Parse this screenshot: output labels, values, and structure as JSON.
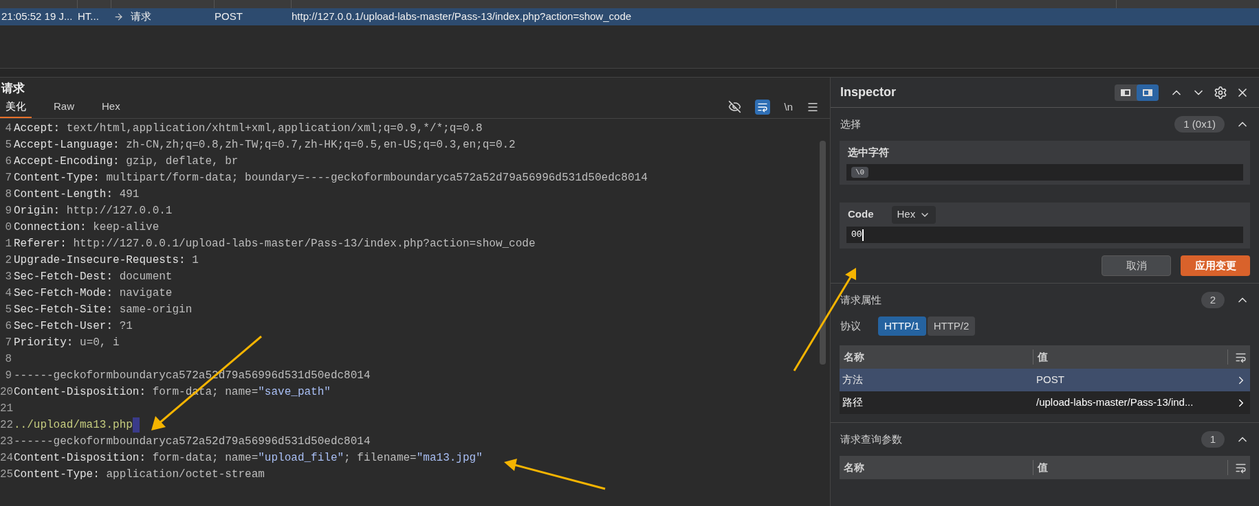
{
  "request_list": {
    "rows": [
      {
        "time": "21:05:52 19 J...",
        "type": "HT...",
        "direction": "请求",
        "method": "POST",
        "url": "http://127.0.0.1/upload-labs-master/Pass-13/index.php?action=show_code",
        "selected": true
      }
    ]
  },
  "request_panel": {
    "title": "请求",
    "tabs": [
      {
        "label": "美化",
        "selected": true
      },
      {
        "label": "Raw",
        "selected": false
      },
      {
        "label": "Hex",
        "selected": false
      }
    ],
    "toolbar": {
      "newline_label": "\\n",
      "wrap_on": true
    },
    "lines": [
      {
        "number": "4",
        "selected_char": false,
        "parts": [
          {
            "kind": "key",
            "text": "Accept:"
          },
          {
            "kind": "text",
            "text": " text/html,application/xhtml+xml,application/xml;q=0.9,*/*;q=0.8"
          }
        ]
      },
      {
        "number": "5",
        "selected_char": false,
        "parts": [
          {
            "kind": "key",
            "text": "Accept-Language:"
          },
          {
            "kind": "text",
            "text": " zh-CN,zh;q=0.8,zh-TW;q=0.7,zh-HK;q=0.5,en-US;q=0.3,en;q=0.2"
          }
        ]
      },
      {
        "number": "6",
        "selected_char": false,
        "parts": [
          {
            "kind": "key",
            "text": "Accept-Encoding:"
          },
          {
            "kind": "text",
            "text": " gzip, deflate, br"
          }
        ]
      },
      {
        "number": "7",
        "selected_char": false,
        "parts": [
          {
            "kind": "key",
            "text": "Content-Type:"
          },
          {
            "kind": "text",
            "text": " multipart/form-data; boundary=----geckoformboundaryca572a52d79a56996d531d50edc8014"
          }
        ]
      },
      {
        "number": "8",
        "selected_char": false,
        "parts": [
          {
            "kind": "key",
            "text": "Content-Length:"
          },
          {
            "kind": "text",
            "text": " 491"
          }
        ]
      },
      {
        "number": "9",
        "selected_char": false,
        "parts": [
          {
            "kind": "key",
            "text": "Origin:"
          },
          {
            "kind": "text",
            "text": " http://127.0.0.1"
          }
        ]
      },
      {
        "number": "0",
        "selected_char": false,
        "parts": [
          {
            "kind": "key",
            "text": "Connection:"
          },
          {
            "kind": "text",
            "text": " keep-alive"
          }
        ]
      },
      {
        "number": "1",
        "selected_char": false,
        "parts": [
          {
            "kind": "key",
            "text": "Referer:"
          },
          {
            "kind": "text",
            "text": " http://127.0.0.1/upload-labs-master/Pass-13/index.php?action=show_code"
          }
        ]
      },
      {
        "number": "2",
        "selected_char": false,
        "parts": [
          {
            "kind": "key",
            "text": "Upgrade-Insecure-Requests:"
          },
          {
            "kind": "text",
            "text": " 1"
          }
        ]
      },
      {
        "number": "3",
        "selected_char": false,
        "parts": [
          {
            "kind": "key",
            "text": "Sec-Fetch-Dest:"
          },
          {
            "kind": "text",
            "text": " document"
          }
        ]
      },
      {
        "number": "4",
        "selected_char": false,
        "parts": [
          {
            "kind": "key",
            "text": "Sec-Fetch-Mode:"
          },
          {
            "kind": "text",
            "text": " navigate"
          }
        ]
      },
      {
        "number": "5",
        "selected_char": false,
        "parts": [
          {
            "kind": "key",
            "text": "Sec-Fetch-Site:"
          },
          {
            "kind": "text",
            "text": " same-origin"
          }
        ]
      },
      {
        "number": "6",
        "selected_char": false,
        "parts": [
          {
            "kind": "key",
            "text": "Sec-Fetch-User:"
          },
          {
            "kind": "text",
            "text": " ?1"
          }
        ]
      },
      {
        "number": "7",
        "selected_char": false,
        "parts": [
          {
            "kind": "key",
            "text": "Priority:"
          },
          {
            "kind": "text",
            "text": " u=0, i"
          }
        ]
      },
      {
        "number": "8",
        "selected_char": false
      },
      {
        "number": "9",
        "selected_char": false,
        "parts": [
          {
            "kind": "text",
            "text": "------geckoformboundaryca572a52d79a56996d531d50edc8014"
          }
        ]
      },
      {
        "number": "20",
        "selected_char": false,
        "parts": [
          {
            "kind": "key",
            "text": "Content-Disposition:"
          },
          {
            "kind": "text",
            "text": " form-data; name="
          },
          {
            "kind": "string",
            "text": "\"save_path\""
          }
        ]
      },
      {
        "number": "21",
        "selected_char": false
      },
      {
        "number": "22",
        "selected_char": true,
        "parts": [
          {
            "kind": "body",
            "text": "../upload/ma13.php"
          }
        ]
      },
      {
        "number": "23",
        "selected_char": false,
        "parts": [
          {
            "kind": "text",
            "text": "------geckoformboundaryca572a52d79a56996d531d50edc8014"
          }
        ]
      },
      {
        "number": "24",
        "selected_char": false,
        "parts": [
          {
            "kind": "key",
            "text": "Content-Disposition:"
          },
          {
            "kind": "text",
            "text": " form-data; name="
          },
          {
            "kind": "string",
            "text": "\"upload_file\""
          },
          {
            "kind": "text",
            "text": "; filename="
          },
          {
            "kind": "string",
            "text": "\"ma13.jpg\""
          }
        ]
      },
      {
        "number": "25",
        "selected_char": false,
        "parts": [
          {
            "kind": "key",
            "text": "Content-Type:"
          },
          {
            "kind": "text",
            "text": " application/octet-stream"
          }
        ]
      }
    ]
  },
  "inspector": {
    "title": "Inspector",
    "layout_buttons": [
      {
        "selected": false
      },
      {
        "selected": true
      }
    ],
    "selection": {
      "title": "选择",
      "count": "1 (0x1)",
      "expanded": true,
      "selected_chars": {
        "label": "选中字符",
        "chars": [
          "\\0"
        ]
      },
      "code": {
        "label": "Code",
        "format": "Hex",
        "value": "00"
      },
      "buttons": [
        {
          "label": "取消",
          "kind": "secondary"
        },
        {
          "label": "应用变更",
          "kind": "primary"
        }
      ]
    },
    "attributes": {
      "title": "请求属性",
      "count": "2",
      "expanded": true,
      "protocol": {
        "label": "协议",
        "options": [
          {
            "label": "HTTP/1",
            "selected": true
          },
          {
            "label": "HTTP/2",
            "selected": false
          }
        ]
      },
      "table": {
        "columns": [
          "名称",
          "值"
        ],
        "rows": [
          {
            "name": "方法",
            "value": "POST",
            "selected": true
          },
          {
            "name": "路径",
            "value": "/upload-labs-master/Pass-13/ind...",
            "selected": false
          }
        ]
      }
    },
    "query": {
      "title": "请求查询参数",
      "count": "1",
      "expanded": true,
      "table": {
        "columns": [
          "名称",
          "值"
        ]
      }
    }
  }
}
